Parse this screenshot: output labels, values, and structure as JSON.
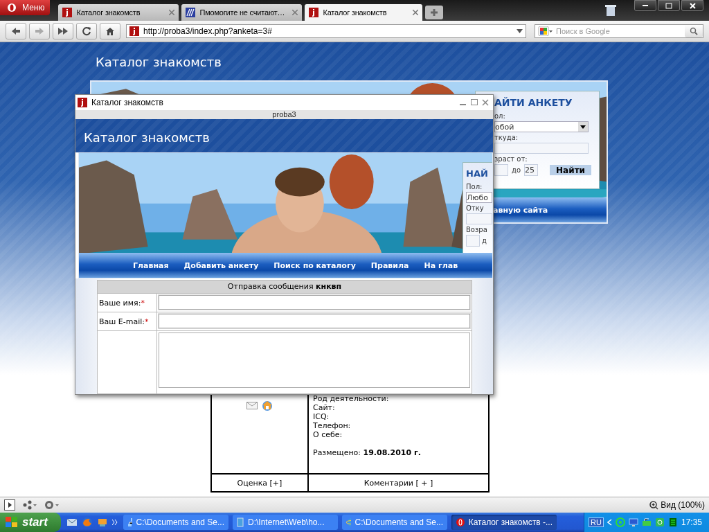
{
  "browser": {
    "menu_label": "Меню",
    "tabs": [
      {
        "label": "Каталог знакомств",
        "selected": false,
        "kind": "site"
      },
      {
        "label": "Пмомогите не считают…",
        "selected": false,
        "kind": "forum"
      },
      {
        "label": "Каталог знакомств",
        "selected": true,
        "kind": "site"
      }
    ]
  },
  "address_bar": {
    "url": "http://proba3/index.php?anketa=3#",
    "search_placeholder": "Поиск в Google"
  },
  "page": {
    "title": "Каталог знакомств",
    "search_panel": {
      "title": "АЙТИ АНКЕТУ",
      "gender_label": "ол:",
      "gender_value": "обой",
      "from_label": "ткуда:",
      "age_label": "зраст от:",
      "age_to_label": "до",
      "age_to_value": "25",
      "button": "Найти"
    },
    "nav_items": [
      "авную сайта"
    ],
    "profile": {
      "fields": [
        "Род деятельности:",
        "Сайт:",
        "ICQ:",
        "Телефон:",
        "О себе:"
      ],
      "posted_label": "Размещено:",
      "posted_date": "19.08.2010 г.",
      "rating_link": "Оценка [+]",
      "comments_link": "Коментарии [ + ]"
    }
  },
  "popup": {
    "title": "Каталог знакомств",
    "address": "proba3",
    "page_title": "Каталог знакомств",
    "search_panel": {
      "title": "НАЙ",
      "gender_label": "Пол:",
      "gender_value": "Любо",
      "from_label": "Отку",
      "age_label": "Возра",
      "age_to_label": "д"
    },
    "nav_items": [
      "Главная",
      "Добавить анкету",
      "Поиск по каталогу",
      "Правила",
      "На глав"
    ],
    "form": {
      "heading": "Отправка сообщения **кнквп**",
      "fields": [
        {
          "kind": "input",
          "label": "Ваше имя:",
          "required_mark": "*"
        },
        {
          "kind": "input",
          "label": "Ваш E-mail:",
          "required_mark": "*"
        },
        {
          "kind": "textarea"
        }
      ]
    }
  },
  "status_bar": {
    "zoom": "Вид (100%)"
  },
  "taskbar": {
    "start": "start",
    "tasks": [
      {
        "label": "C:\\Documents and Se...",
        "selected": false,
        "kind": "network"
      },
      {
        "label": "D:\\Internet\\Web\\ho...",
        "selected": false,
        "kind": "folder"
      },
      {
        "label": "C:\\Documents and Se...",
        "selected": false,
        "kind": "globe"
      },
      {
        "label": "Каталог знакомств -...",
        "selected": true,
        "kind": "opera"
      }
    ],
    "language": "RU",
    "clock": "17:35"
  }
}
